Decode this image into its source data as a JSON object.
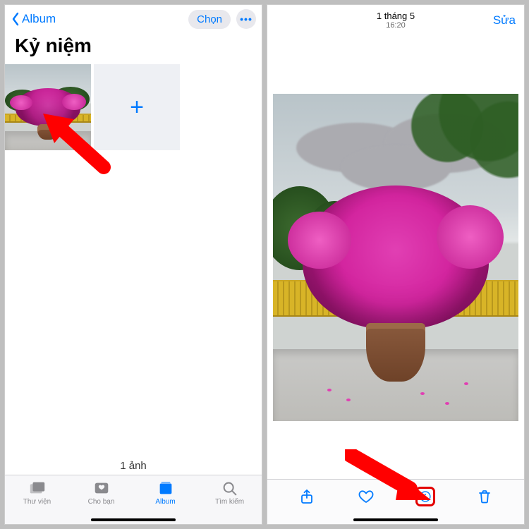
{
  "left": {
    "back_label": "Album",
    "select_label": "Chọn",
    "title": "Kỷ niệm",
    "add_glyph": "+",
    "count_text": "1 ảnh",
    "tabs": [
      {
        "label": "Thư viện"
      },
      {
        "label": "Cho bạn"
      },
      {
        "label": "Album"
      },
      {
        "label": "Tìm kiếm"
      }
    ],
    "active_tab_index": 2
  },
  "right": {
    "date": "1 tháng 5",
    "time": "16:20",
    "edit_label": "Sửa",
    "toolbar_icons": [
      "share-icon",
      "heart-icon",
      "info-icon",
      "trash-icon"
    ]
  },
  "colors": {
    "accent": "#007aff",
    "highlight": "#e30000"
  }
}
